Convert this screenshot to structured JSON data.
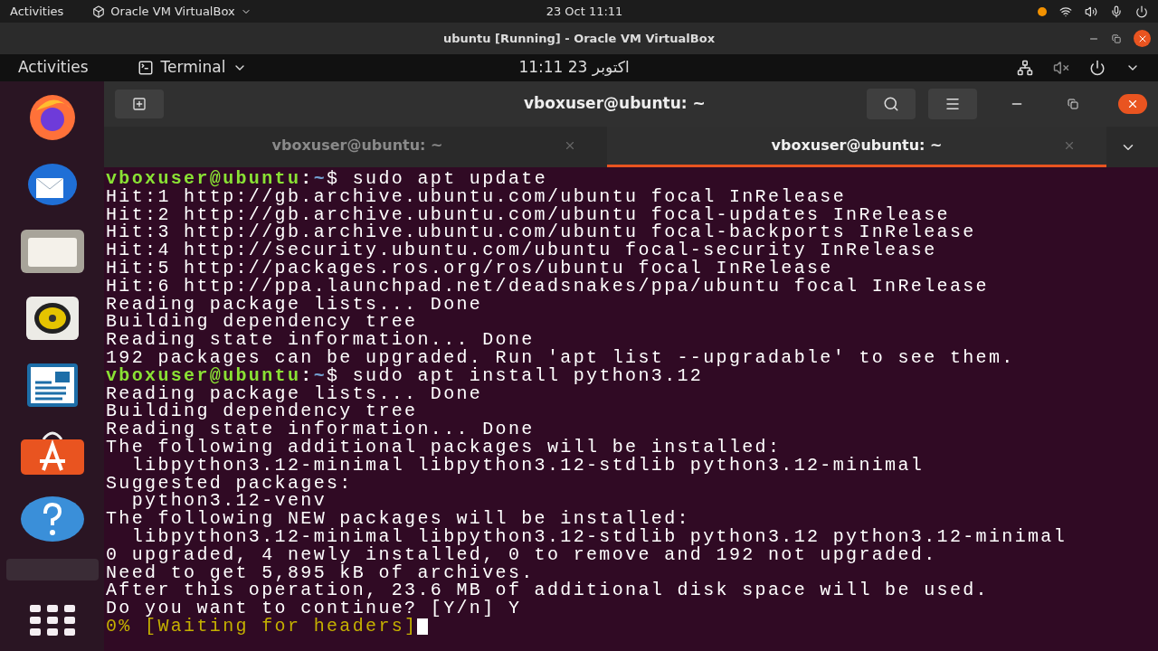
{
  "host_bar": {
    "activities": "Activities",
    "app_menu": "Oracle VM VirtualBox",
    "clock": "23 Oct  11:11"
  },
  "vm_window": {
    "title": "ubuntu [Running] - Oracle VM VirtualBox"
  },
  "guest_bar": {
    "activities": "Activities",
    "app_menu": "Terminal",
    "clock": "11:11  23 اكتوبر"
  },
  "terminal": {
    "title": "vboxuser@ubuntu: ~",
    "tabs": [
      {
        "label": "vboxuser@ubuntu: ~",
        "selected": false
      },
      {
        "label": "vboxuser@ubuntu: ~",
        "selected": true
      }
    ],
    "lines": [
      {
        "kind": "prompt",
        "user": "vboxuser@ubuntu",
        "sep": ":",
        "path": "~",
        "command": "$ sudo apt update"
      },
      {
        "kind": "output",
        "text": "Hit:1 http://gb.archive.ubuntu.com/ubuntu focal InRelease"
      },
      {
        "kind": "output",
        "text": "Hit:2 http://gb.archive.ubuntu.com/ubuntu focal-updates InRelease"
      },
      {
        "kind": "output",
        "text": "Hit:3 http://gb.archive.ubuntu.com/ubuntu focal-backports InRelease"
      },
      {
        "kind": "output",
        "text": "Hit:4 http://security.ubuntu.com/ubuntu focal-security InRelease"
      },
      {
        "kind": "output",
        "text": "Hit:5 http://packages.ros.org/ros/ubuntu focal InRelease"
      },
      {
        "kind": "output",
        "text": "Hit:6 http://ppa.launchpad.net/deadsnakes/ppa/ubuntu focal InRelease"
      },
      {
        "kind": "output",
        "text": "Reading package lists... Done"
      },
      {
        "kind": "output",
        "text": "Building dependency tree"
      },
      {
        "kind": "output",
        "text": "Reading state information... Done"
      },
      {
        "kind": "output",
        "text": "192 packages can be upgraded. Run 'apt list --upgradable' to see them."
      },
      {
        "kind": "prompt",
        "user": "vboxuser@ubuntu",
        "sep": ":",
        "path": "~",
        "command": "$ sudo apt install python3.12"
      },
      {
        "kind": "output",
        "text": "Reading package lists... Done"
      },
      {
        "kind": "output",
        "text": "Building dependency tree"
      },
      {
        "kind": "output",
        "text": "Reading state information... Done"
      },
      {
        "kind": "output",
        "text": "The following additional packages will be installed:"
      },
      {
        "kind": "output",
        "text": "  libpython3.12-minimal libpython3.12-stdlib python3.12-minimal"
      },
      {
        "kind": "output",
        "text": "Suggested packages:"
      },
      {
        "kind": "output",
        "text": "  python3.12-venv"
      },
      {
        "kind": "output",
        "text": "The following NEW packages will be installed:"
      },
      {
        "kind": "output",
        "text": "  libpython3.12-minimal libpython3.12-stdlib python3.12 python3.12-minimal"
      },
      {
        "kind": "output",
        "text": "0 upgraded, 4 newly installed, 0 to remove and 192 not upgraded."
      },
      {
        "kind": "output",
        "text": "Need to get 5,895 kB of archives."
      },
      {
        "kind": "output",
        "text": "After this operation, 23.6 MB of additional disk space will be used."
      },
      {
        "kind": "output",
        "text": "Do you want to continue? [Y/n] Y"
      },
      {
        "kind": "progress",
        "text": "0% [Waiting for headers]"
      }
    ]
  }
}
